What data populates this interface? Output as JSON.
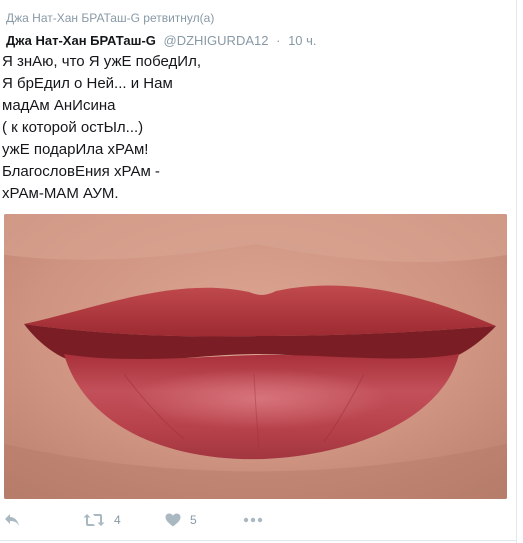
{
  "retweet_context": "Джа Нат-Хан БРАТаш-G ретвитнул(а)",
  "tweet": {
    "author_name": "Джа Нат-Хан БРАТаш-G",
    "handle": "@DZHIGURDA12",
    "separator": "·",
    "timestamp": "10 ч.",
    "text_lines": [
      "Я знАю, что Я ужЕ победИл,",
      "Я брЕдил о Ней... и Нам",
      "мадАм АнИсина",
      "( к которой остЫл...)",
      "ужЕ подарИла хРАм!",
      "БлагословЕния хРАм -",
      "хРАм-МАМ АУМ."
    ]
  },
  "actions": {
    "reply_icon": "reply-icon",
    "retweet_icon": "retweet-icon",
    "retweet_count": "4",
    "like_icon": "heart-icon",
    "like_count": "5",
    "more_icon": "more-dots-icon"
  },
  "colors": {
    "secondary_text": "#8899a6",
    "action_icon": "#aab8c2",
    "lip_color": "#b83a3e",
    "skin_color": "#d49a86"
  }
}
